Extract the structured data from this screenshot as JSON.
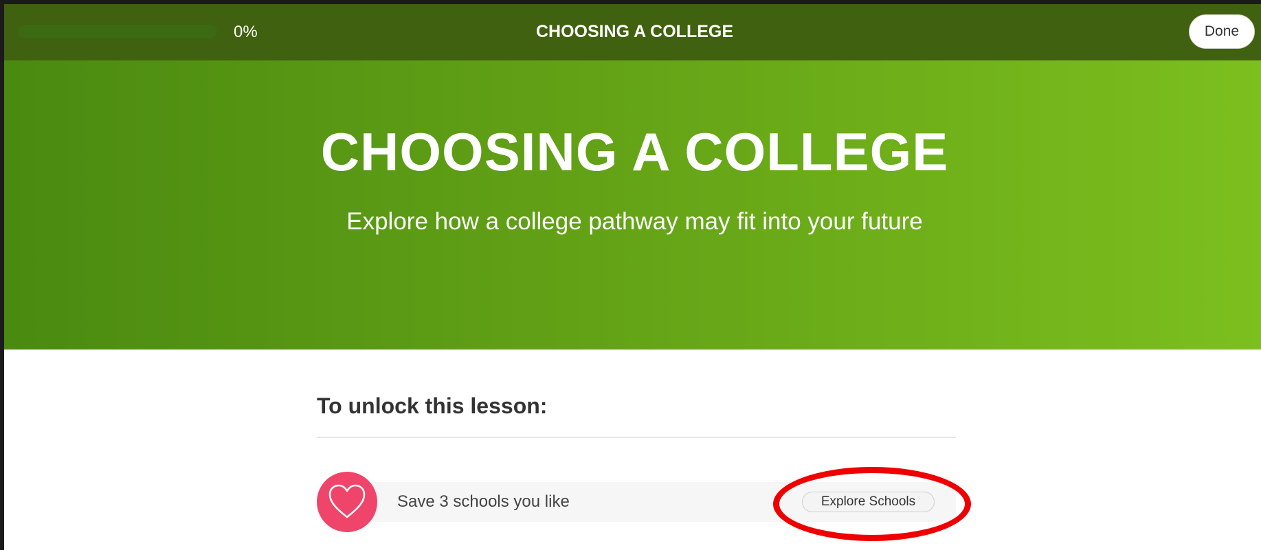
{
  "topbar": {
    "progress_value": 0,
    "progress_label": "0%",
    "title": "CHOOSING A COLLEGE",
    "done_label": "Done"
  },
  "hero": {
    "title": "CHOOSING A COLLEGE",
    "subtitle": "Explore how a college pathway may fit into your future"
  },
  "unlock": {
    "heading": "To unlock this lesson:",
    "requirements": [
      {
        "icon": "heart-icon",
        "label": "Save 3 schools you like",
        "button_label": "Explore Schools"
      }
    ]
  },
  "colors": {
    "topbar": "#40610f",
    "hero_start": "#4a8a10",
    "hero_end": "#7cbf1e",
    "heart_badge": "#f0456a",
    "highlight": "#ee0000"
  }
}
